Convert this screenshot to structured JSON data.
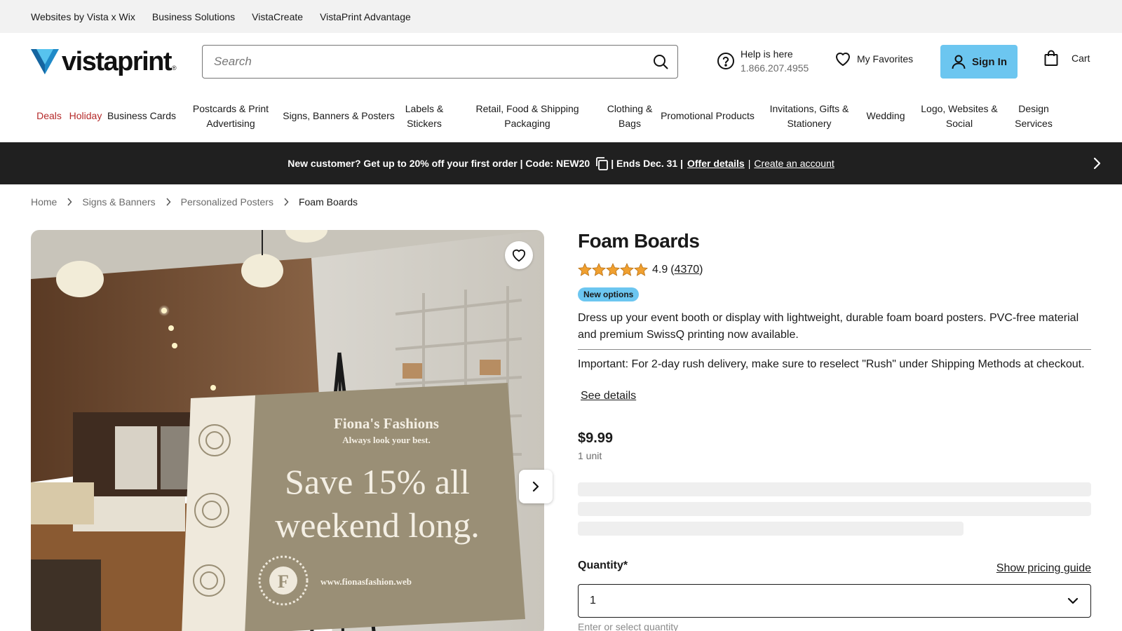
{
  "utility_bar": {
    "links": [
      "Websites by Vista x Wix",
      "Business Solutions",
      "VistaCreate",
      "VistaPrint Advantage"
    ]
  },
  "header": {
    "logo_text": "vistaprint",
    "logo_mark": "®",
    "search_placeholder": "Search",
    "help_title": "Help is here",
    "help_phone": "1.866.207.4955",
    "favorites_label": "My Favorites",
    "signin_label": "Sign In",
    "cart_label": "Cart"
  },
  "category_nav": [
    {
      "label": "Deals",
      "highlight": true
    },
    {
      "label": "Holiday",
      "highlight": true
    },
    {
      "label": "Business Cards",
      "highlight": false
    },
    {
      "label": "Postcards & Print Advertising",
      "highlight": false
    },
    {
      "label": "Signs, Banners & Posters",
      "highlight": false
    },
    {
      "label": "Labels & Stickers",
      "highlight": false
    },
    {
      "label": "Retail, Food & Shipping Packaging",
      "highlight": false
    },
    {
      "label": "Clothing & Bags",
      "highlight": false
    },
    {
      "label": "Promotional Products",
      "highlight": false
    },
    {
      "label": "Invitations, Gifts & Stationery",
      "highlight": false
    },
    {
      "label": "Wedding",
      "highlight": false
    },
    {
      "label": "Logo, Websites & Social",
      "highlight": false
    },
    {
      "label": "Design Services",
      "highlight": false
    }
  ],
  "promo": {
    "text_before_code_icon": "New customer? Get up to 20% off your first order | Code: NEW20",
    "text_ends": "| Ends Dec. 31 |",
    "offer_link": "Offer details",
    "separator": "|",
    "create_link": "Create an account"
  },
  "breadcrumb": {
    "items": [
      "Home",
      "Signs & Banners",
      "Personalized Posters"
    ],
    "current": "Foam Boards"
  },
  "gallery": {
    "sign_business": "Fiona's Fashions",
    "sign_tagline": "Always look your best.",
    "sign_headline_1": "Save 15% all",
    "sign_headline_2": "weekend long.",
    "sign_monogram": "F",
    "sign_url": "www.fionasfashion.web"
  },
  "product": {
    "title": "Foam Boards",
    "rating_value": "4.9",
    "rating_count": "4370",
    "rating_stars": 5,
    "badge": "New options",
    "description": "Dress up your event booth or display with lightweight, durable foam board posters. PVC-free material and premium SwissQ printing now available.",
    "important_note": "Important: For 2-day rush delivery, make sure to reselect \"Rush\" under Shipping Methods at checkout.",
    "see_details": "See details",
    "price": "$9.99",
    "unit": "1 unit",
    "quantity_label": "Quantity*",
    "pricing_guide": "Show pricing guide",
    "quantity_value": "1",
    "quantity_hint": "Enter or select quantity"
  },
  "colors": {
    "accent_blue": "#6cc6f0",
    "promo_bg": "#202020",
    "deal_red": "#b52a2a",
    "star_orange": "#f0a030"
  }
}
